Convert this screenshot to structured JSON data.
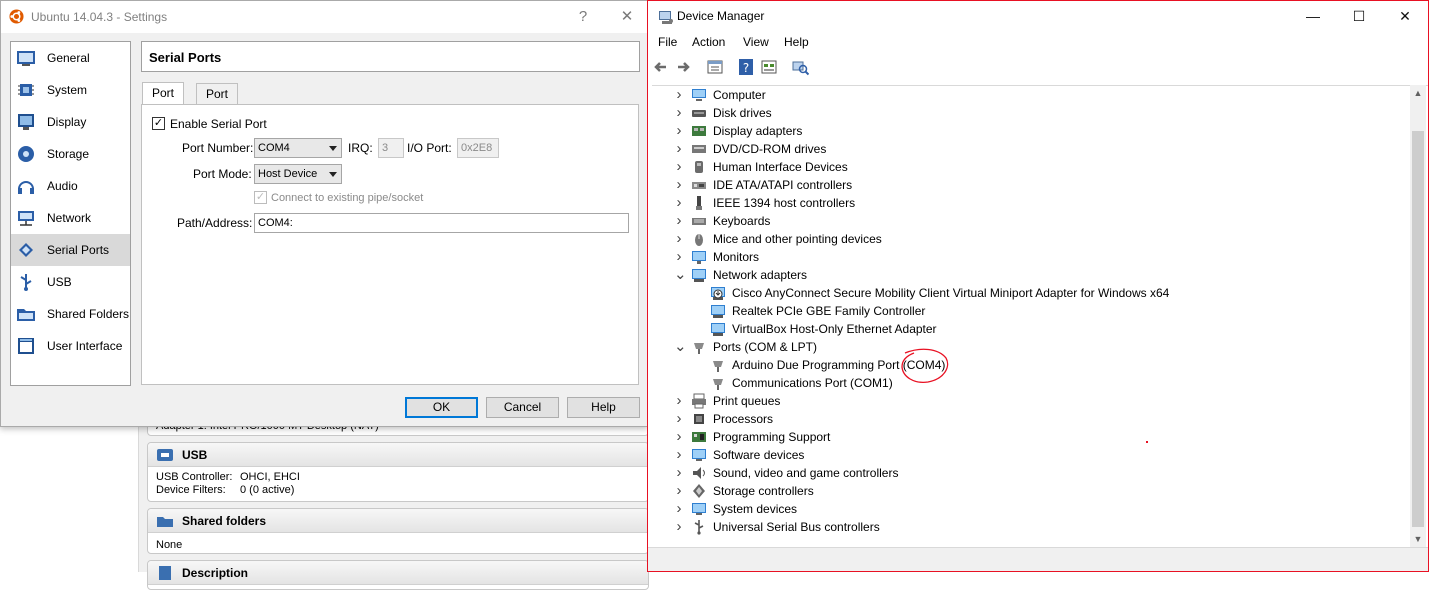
{
  "settings": {
    "title": "Ubuntu 14.04.3 - Settings",
    "help_glyph": "?",
    "close_glyph": "✕",
    "nav": [
      {
        "label": "General",
        "icon": "general-icon"
      },
      {
        "label": "System",
        "icon": "system-icon"
      },
      {
        "label": "Display",
        "icon": "display-icon"
      },
      {
        "label": "Storage",
        "icon": "storage-icon"
      },
      {
        "label": "Audio",
        "icon": "audio-icon"
      },
      {
        "label": "Network",
        "icon": "network-icon"
      },
      {
        "label": "Serial Ports",
        "icon": "serial-ports-icon",
        "active": true
      },
      {
        "label": "USB",
        "icon": "usb-icon"
      },
      {
        "label": "Shared Folders",
        "icon": "shared-folders-icon"
      },
      {
        "label": "User Interface",
        "icon": "user-interface-icon"
      }
    ],
    "panel_title": "Serial Ports",
    "tabs": [
      "Port 1",
      "Port 2"
    ],
    "enable_label": "Enable Serial Port",
    "enable_checked": true,
    "port_number_label": "Port Number:",
    "port_number_value": "COM4",
    "irq_label": "IRQ:",
    "irq_value": "3",
    "io_port_label": "I/O Port:",
    "io_port_value": "0x2E8",
    "port_mode_label": "Port Mode:",
    "port_mode_value": "Host Device",
    "connect_label": "Connect to existing pipe/socket",
    "path_label": "Path/Address:",
    "path_value": "COM4:",
    "ok_label": "OK",
    "cancel_label": "Cancel",
    "help_label": "Help",
    "check_glyph": "✓"
  },
  "vbox_details": {
    "network_partial": "Adapter 1:   Intel PRO/1000 MT Desktop (NAT)",
    "usb_title": "USB",
    "usb_rows": [
      {
        "key": "USB Controller:",
        "value": "OHCI, EHCI"
      },
      {
        "key": "Device Filters:",
        "value": "0 (0 active)"
      }
    ],
    "shared_title": "Shared folders",
    "shared_value": "None",
    "description_title": "Description"
  },
  "devmgr": {
    "title": "Device Manager",
    "minimize_glyph": "—",
    "maximize_glyph": "☐",
    "close_glyph": "✕",
    "menu": [
      "File",
      "Action",
      "View",
      "Help"
    ],
    "toolbar_icons": [
      "back-icon",
      "forward-icon",
      "properties-icon",
      "help-icon",
      "show-hide-icon",
      "scan-hardware-icon"
    ],
    "tree": [
      {
        "label": "Computer",
        "icon": "computer-icon",
        "level": 0,
        "expander": ">"
      },
      {
        "label": "Disk drives",
        "icon": "disk-drive-icon",
        "level": 0,
        "expander": ">"
      },
      {
        "label": "Display adapters",
        "icon": "display-adapter-icon",
        "level": 0,
        "expander": ">"
      },
      {
        "label": "DVD/CD-ROM drives",
        "icon": "dvd-icon",
        "level": 0,
        "expander": ">"
      },
      {
        "label": "Human Interface Devices",
        "icon": "hid-icon",
        "level": 0,
        "expander": ">"
      },
      {
        "label": "IDE ATA/ATAPI controllers",
        "icon": "ide-icon",
        "level": 0,
        "expander": ">"
      },
      {
        "label": "IEEE 1394 host controllers",
        "icon": "ieee1394-icon",
        "level": 0,
        "expander": ">"
      },
      {
        "label": "Keyboards",
        "icon": "keyboard-icon",
        "level": 0,
        "expander": ">"
      },
      {
        "label": "Mice and other pointing devices",
        "icon": "mouse-icon",
        "level": 0,
        "expander": ">"
      },
      {
        "label": "Monitors",
        "icon": "monitor-icon",
        "level": 0,
        "expander": ">"
      },
      {
        "label": "Network adapters",
        "icon": "network-adapter-icon",
        "level": 0,
        "expander": "v"
      },
      {
        "label": "Cisco AnyConnect Secure Mobility Client Virtual Miniport Adapter for Windows x64",
        "icon": "network-adapter-warning-icon",
        "level": 1,
        "expander": ""
      },
      {
        "label": "Realtek PCIe GBE Family Controller",
        "icon": "network-adapter-icon",
        "level": 1,
        "expander": ""
      },
      {
        "label": "VirtualBox Host-Only Ethernet Adapter",
        "icon": "network-adapter-icon",
        "level": 1,
        "expander": ""
      },
      {
        "label": "Ports (COM & LPT)",
        "icon": "port-icon",
        "level": 0,
        "expander": "v"
      },
      {
        "label": "Arduino Due Programming Port (COM4)",
        "icon": "port-icon",
        "level": 1,
        "expander": ""
      },
      {
        "label": "Communications Port (COM1)",
        "icon": "port-icon",
        "level": 1,
        "expander": ""
      },
      {
        "label": "Print queues",
        "icon": "printer-icon",
        "level": 0,
        "expander": ">"
      },
      {
        "label": "Processors",
        "icon": "processor-icon",
        "level": 0,
        "expander": ">"
      },
      {
        "label": "Programming Support",
        "icon": "programming-support-icon",
        "level": 0,
        "expander": ">"
      },
      {
        "label": "Software devices",
        "icon": "software-device-icon",
        "level": 0,
        "expander": ">"
      },
      {
        "label": "Sound, video and game controllers",
        "icon": "sound-icon",
        "level": 0,
        "expander": ">"
      },
      {
        "label": "Storage controllers",
        "icon": "storage-controller-icon",
        "level": 0,
        "expander": ">"
      },
      {
        "label": "System devices",
        "icon": "system-device-icon",
        "level": 0,
        "expander": ">"
      },
      {
        "label": "Universal Serial Bus controllers",
        "icon": "usb-controller-icon",
        "level": 0,
        "expander": ">"
      }
    ],
    "annotation_color": "#e81123"
  }
}
